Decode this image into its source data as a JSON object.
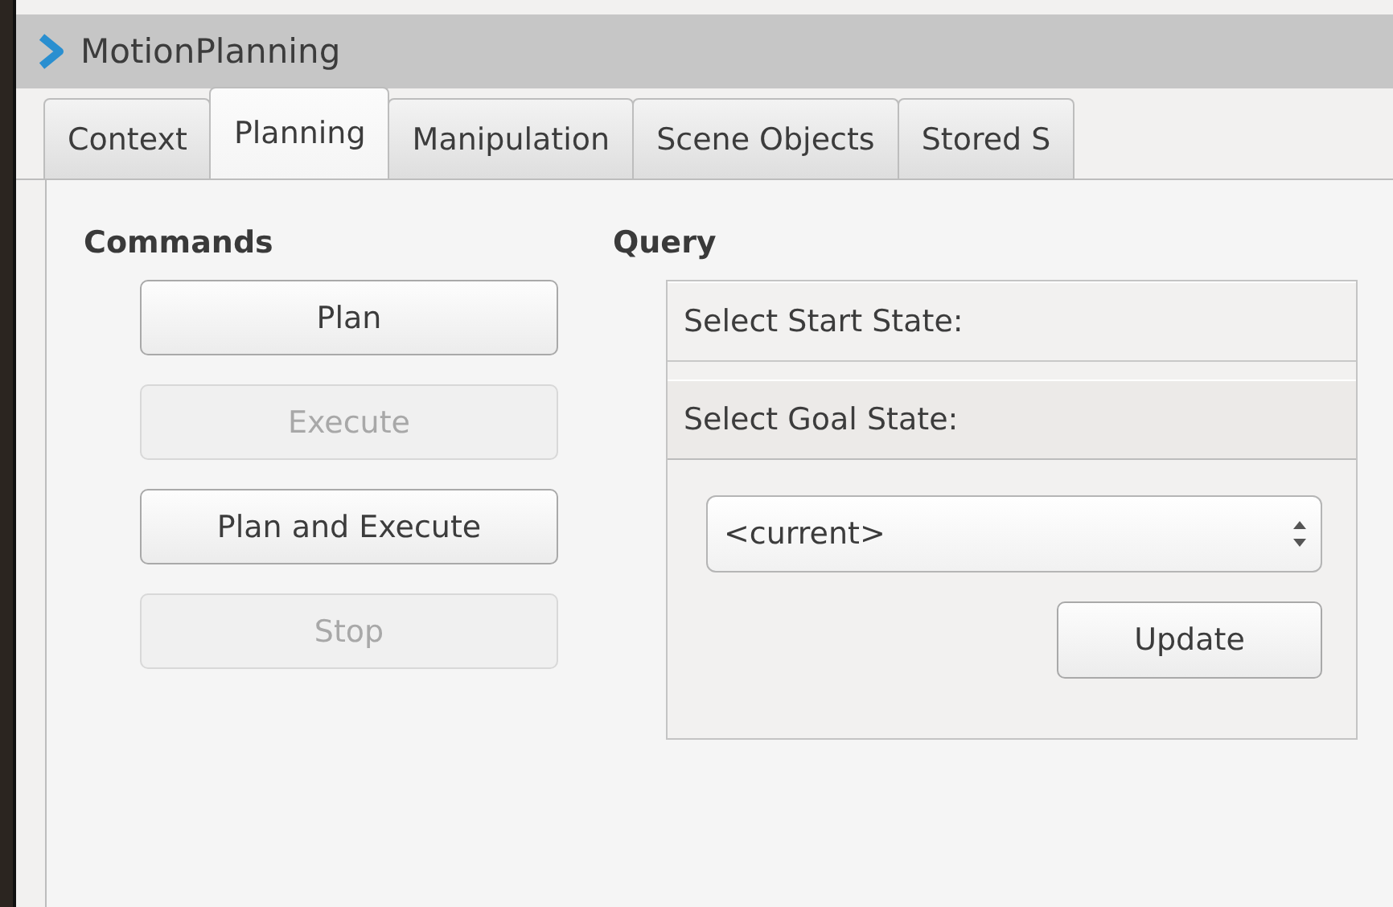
{
  "window": {
    "title": "MotionPlanning"
  },
  "tabs": [
    {
      "label": "Context",
      "selected": false
    },
    {
      "label": "Planning",
      "selected": true
    },
    {
      "label": "Manipulation",
      "selected": false
    },
    {
      "label": "Scene Objects",
      "selected": false
    },
    {
      "label": "Stored S",
      "selected": false
    }
  ],
  "commands": {
    "heading": "Commands",
    "buttons": [
      {
        "label": "Plan",
        "disabled": false
      },
      {
        "label": "Execute",
        "disabled": true
      },
      {
        "label": "Plan and Execute",
        "disabled": false
      },
      {
        "label": "Stop",
        "disabled": true
      }
    ]
  },
  "query": {
    "heading": "Query",
    "sections": [
      {
        "label": "Select Start State:",
        "expanded": false
      },
      {
        "label": "Select Goal State:",
        "expanded": true
      }
    ],
    "state_selector": {
      "value": "<current>"
    },
    "update_button": "Update"
  }
}
